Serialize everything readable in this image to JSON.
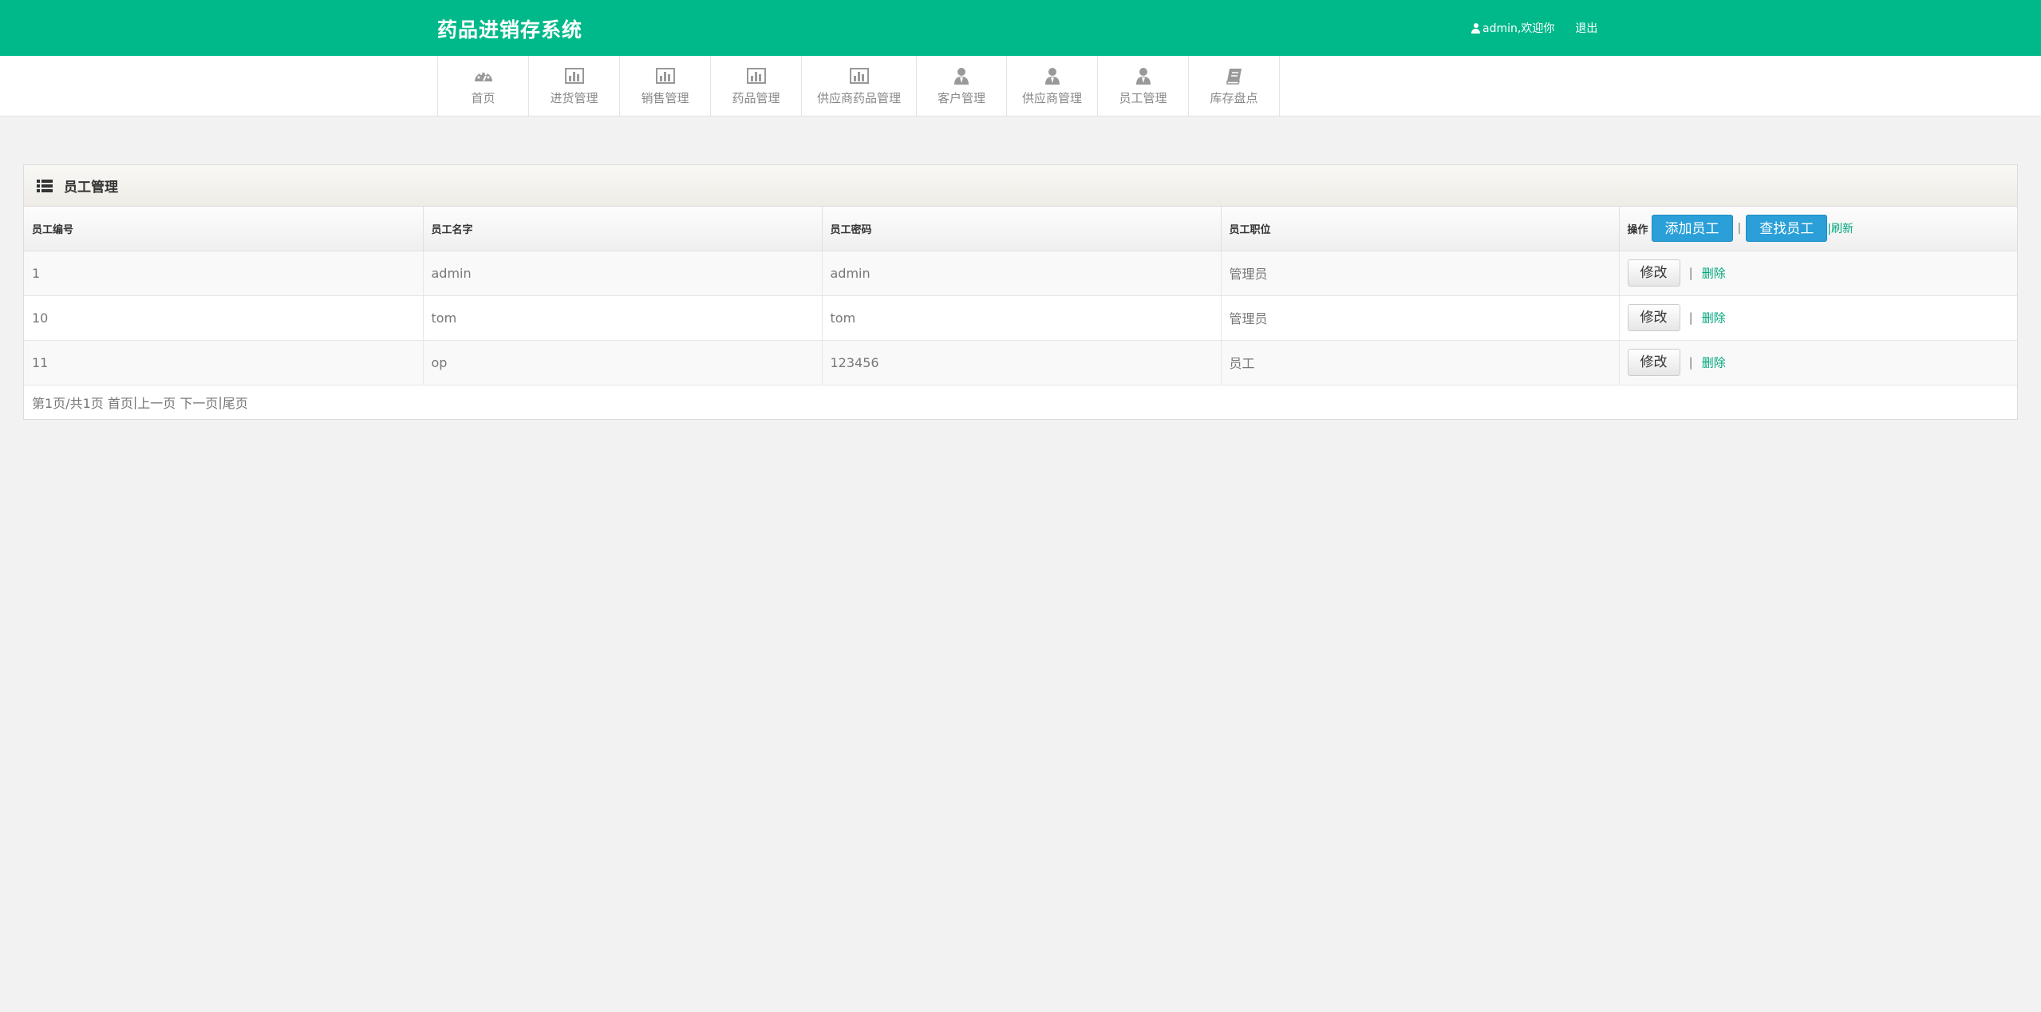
{
  "header": {
    "brand": "药品进销存系统",
    "user_text": "admin,欢迎你",
    "logout": "退出"
  },
  "nav": {
    "items": [
      {
        "label": "首页",
        "icon": "dashboard-icon"
      },
      {
        "label": "进货管理",
        "icon": "bar-chart-icon"
      },
      {
        "label": "销售管理",
        "icon": "bar-chart-icon"
      },
      {
        "label": "药品管理",
        "icon": "bar-chart-icon"
      },
      {
        "label": "供应商药品管理",
        "icon": "bar-chart-icon"
      },
      {
        "label": "客户管理",
        "icon": "user-tie-icon"
      },
      {
        "label": "供应商管理",
        "icon": "user-tie-icon"
      },
      {
        "label": "员工管理",
        "icon": "user-tie-icon"
      },
      {
        "label": "库存盘点",
        "icon": "book-icon"
      }
    ]
  },
  "panel": {
    "title": "员工管理",
    "icon": "list-icon"
  },
  "table": {
    "columns": [
      "员工编号",
      "员工名字",
      "员工密码",
      "员工职位"
    ],
    "op_label": "操作",
    "add_button": "添加员工",
    "find_button": "查找员工",
    "separator": "|",
    "refresh": "|刷新",
    "rows": [
      {
        "id": "1",
        "name": "admin",
        "password": "admin",
        "position": "管理员"
      },
      {
        "id": "10",
        "name": "tom",
        "password": "tom",
        "position": "管理员"
      },
      {
        "id": "11",
        "name": "op",
        "password": "123456",
        "position": "员工"
      }
    ],
    "edit_label": "修改",
    "row_separator": "|",
    "delete_label": "删除"
  },
  "pager": {
    "info": "第1页/共1页",
    "first": "首页",
    "sep": "|",
    "prev": "上一页",
    "next": "下一页",
    "last": "尾页"
  },
  "colors": {
    "brand_green": "#00b98a",
    "button_blue": "#2a9fd8",
    "link_green": "#00a67c"
  }
}
